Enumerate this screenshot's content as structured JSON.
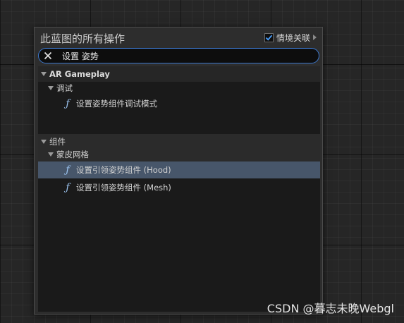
{
  "panel": {
    "title": "此蓝图的所有操作",
    "context_sensitive": {
      "label": "情境关联",
      "checked": true
    }
  },
  "search": {
    "value": "设置 姿势",
    "clear_icon": "close-icon"
  },
  "tree": {
    "categories": [
      {
        "label": "AR Gameplay",
        "subcategories": [
          {
            "label": "调试",
            "items": [
              {
                "label": "设置姿势组件调试模式",
                "icon": "function-icon"
              }
            ]
          }
        ]
      },
      {
        "label": "组件",
        "subcategories": [
          {
            "label": "蒙皮网格",
            "items": [
              {
                "label": "设置引领姿势组件 (Hood)",
                "icon": "function-icon",
                "selected": true
              },
              {
                "label": "设置引领姿势组件 (Mesh)",
                "icon": "function-icon"
              }
            ]
          }
        ]
      }
    ]
  },
  "watermark": "CSDN @暮志未晚Webgl",
  "colors": {
    "accent": "#3d7ad1",
    "selected_row": "#47566a",
    "function_icon": "#9cc4f0"
  }
}
